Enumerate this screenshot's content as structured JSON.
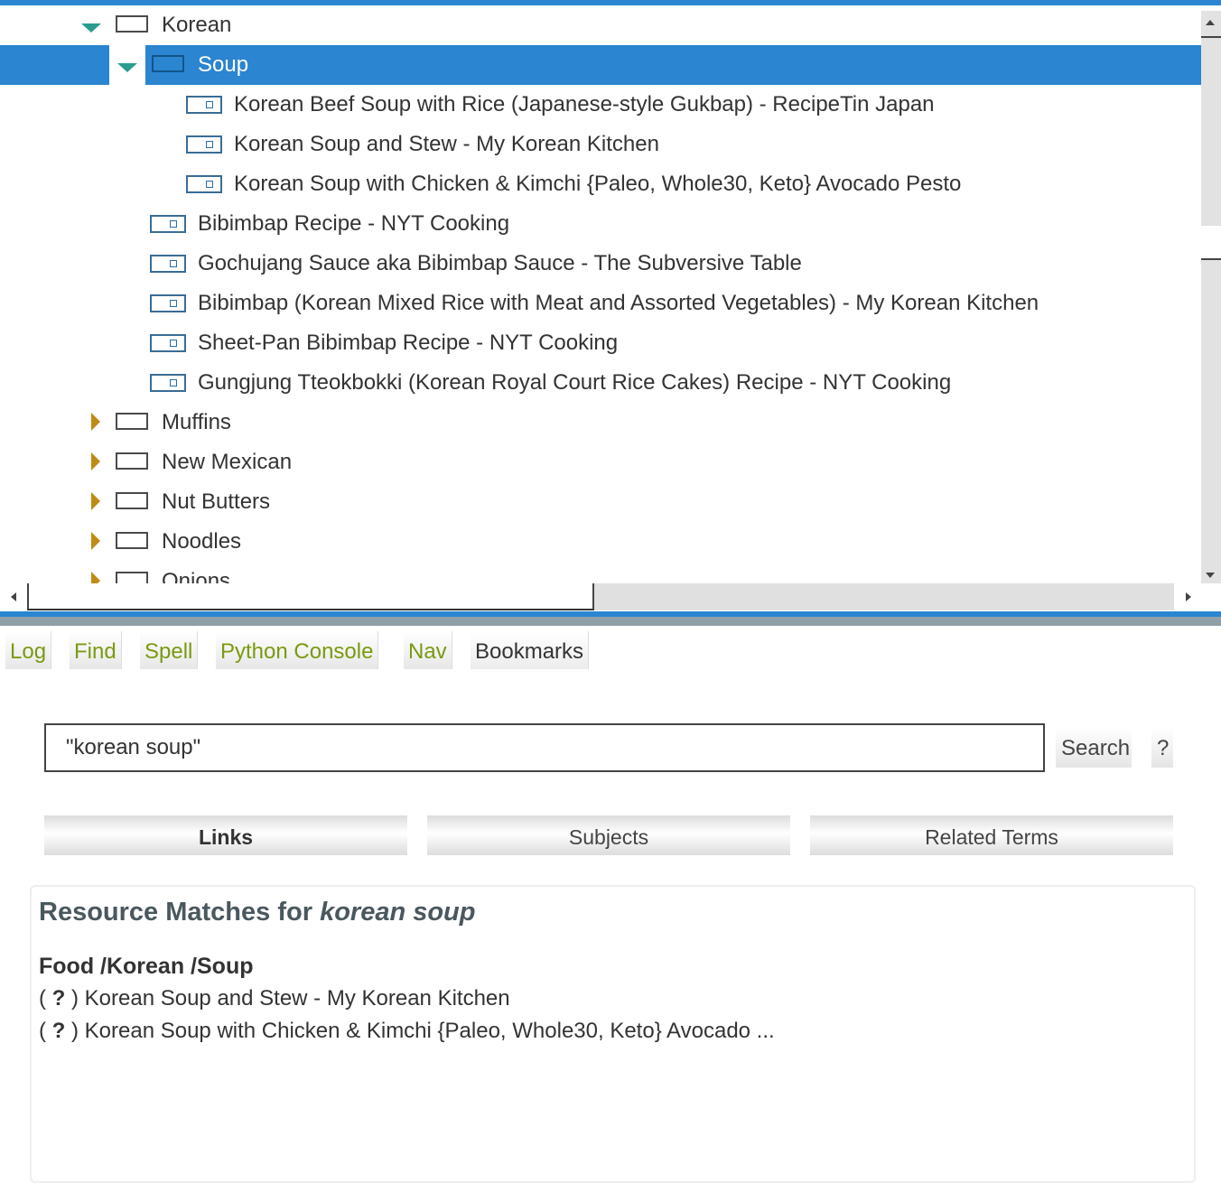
{
  "tree": {
    "rows": [
      {
        "label": "Korean",
        "type": "folder",
        "expanded": true,
        "level": 1
      },
      {
        "label": "Soup",
        "type": "folder",
        "expanded": true,
        "level": 2,
        "selected": true
      },
      {
        "label": "Korean Beef Soup with Rice (Japanese-style Gukbap) - RecipeTin Japan",
        "type": "link",
        "level": 3
      },
      {
        "label": "Korean Soup and Stew - My Korean Kitchen",
        "type": "link",
        "level": 3
      },
      {
        "label": "Korean Soup with Chicken & Kimchi {Paleo, Whole30, Keto} Avocado Pesto",
        "type": "link",
        "level": 3
      },
      {
        "label": "Bibimbap Recipe - NYT Cooking",
        "type": "link",
        "level": 2
      },
      {
        "label": "Gochujang Sauce aka Bibimbap Sauce - The Subversive Table",
        "type": "link",
        "level": 2
      },
      {
        "label": "Bibimbap (Korean Mixed Rice with Meat and Assorted Vegetables) - My Korean Kitchen",
        "type": "link",
        "level": 2
      },
      {
        "label": "Sheet-Pan Bibimbap Recipe - NYT Cooking",
        "type": "link",
        "level": 2
      },
      {
        "label": "Gungjung Tteokbokki (Korean Royal Court Rice Cakes) Recipe - NYT Cooking",
        "type": "link",
        "level": 2
      },
      {
        "label": "Muffins",
        "type": "folder",
        "expanded": false,
        "level": 1
      },
      {
        "label": "New Mexican",
        "type": "folder",
        "expanded": false,
        "level": 1
      },
      {
        "label": "Nut Butters",
        "type": "folder",
        "expanded": false,
        "level": 1
      },
      {
        "label": "Noodles",
        "type": "folder",
        "expanded": false,
        "level": 1
      },
      {
        "label": "Onions",
        "type": "folder",
        "expanded": false,
        "level": 1
      }
    ]
  },
  "tabs": {
    "items": [
      "Log",
      "Find",
      "Spell",
      "Python Console",
      "Nav",
      "Bookmarks"
    ],
    "active": "Bookmarks"
  },
  "search": {
    "value": "\"korean soup\"",
    "button_label": "Search",
    "help_label": "?"
  },
  "subtabs": {
    "items": [
      "Links",
      "Subjects",
      "Related Terms"
    ],
    "active": "Links"
  },
  "results": {
    "title_prefix": "Resource Matches for",
    "title_query": "korean soup",
    "path": "Food /Korean /Soup",
    "items": [
      {
        "marker": "?",
        "text": "Korean Soup and Stew - My Korean Kitchen"
      },
      {
        "marker": "?",
        "text": "Korean Soup with Chicken & Kimchi {Paleo, Whole30, Keto} Avocado ..."
      }
    ]
  },
  "colors": {
    "accent": "#2b85d0",
    "expanded_arrow": "#2a9d8f",
    "collapsed_arrow": "#c08b15",
    "tab_text": "#7a9a10",
    "splitter": "#8fa0a7"
  }
}
